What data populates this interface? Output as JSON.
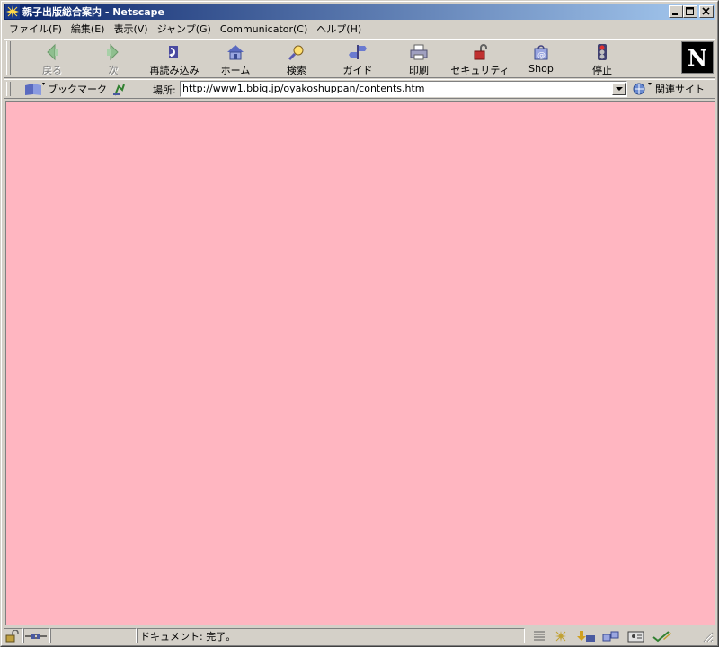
{
  "window": {
    "title": "親子出版総合案内 - Netscape"
  },
  "menu": {
    "items": [
      "ファイル(F)",
      "編集(E)",
      "表示(V)",
      "ジャンプ(G)",
      "Communicator(C)",
      "ヘルプ(H)"
    ]
  },
  "toolbar": {
    "buttons": [
      {
        "label": "戻る",
        "icon": "back-arrow-icon",
        "enabled": false
      },
      {
        "label": "次",
        "icon": "forward-arrow-icon",
        "enabled": false
      },
      {
        "label": "再読み込み",
        "icon": "reload-icon",
        "enabled": true
      },
      {
        "label": "ホーム",
        "icon": "home-icon",
        "enabled": true
      },
      {
        "label": "検索",
        "icon": "search-icon",
        "enabled": true
      },
      {
        "label": "ガイド",
        "icon": "guide-icon",
        "enabled": true
      },
      {
        "label": "印刷",
        "icon": "print-icon",
        "enabled": true
      },
      {
        "label": "セキュリティ",
        "icon": "security-lock-icon",
        "enabled": true
      },
      {
        "label": "Shop",
        "icon": "shop-bag-icon",
        "enabled": true
      },
      {
        "label": "停止",
        "icon": "stop-icon",
        "enabled": true
      }
    ],
    "logo": "N"
  },
  "location": {
    "bookmarks_label": "ブックマーク",
    "location_label": "場所:",
    "url": "http://www1.bbiq.jp/oyakoshuppan/contents.htm",
    "related_label": "関連サイト"
  },
  "content": {
    "background": "#ffb6c1"
  },
  "status": {
    "text": "ドキュメント: 完了。"
  },
  "colors": {
    "titlebar_start": "#0a246a",
    "titlebar_end": "#a6caf0",
    "chrome": "#d4d0c8"
  }
}
